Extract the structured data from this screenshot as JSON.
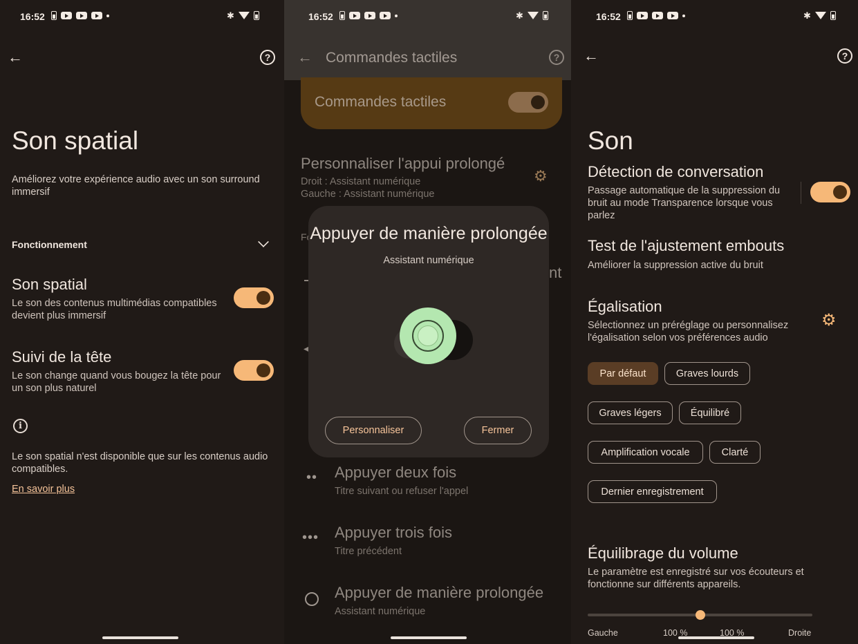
{
  "status": {
    "time": "16:52"
  },
  "panel1": {
    "title": "Son spatial",
    "description": "Améliorez votre expérience audio avec un son surround immersif",
    "section": "Fonctionnement",
    "spatial": {
      "title": "Son spatial",
      "subtitle": "Le son des contenus multimédias compatibles devient plus immersif",
      "on": true
    },
    "head_tracking": {
      "title": "Suivi de la tête",
      "subtitle": "Le son change quand vous bougez la tête pour un son plus naturel",
      "on": true
    },
    "note": "Le son spatial n'est disponible que sur les contenus audio compatibles.",
    "link": "En savoir plus"
  },
  "panel2": {
    "appbar_title": "Commandes tactiles",
    "banner_label": "Commandes tactiles",
    "banner_on": true,
    "customize": {
      "title": "Personnaliser l'appui prolongé",
      "right": "Droit : Assistant numérique",
      "left": "Gauche : Assistant numérique"
    },
    "peek_left": "Fo",
    "peek_right": "nt",
    "modal": {
      "title": "Appuyer de manière prolongée",
      "subtitle": "Assistant numérique",
      "btn_customize": "Personnaliser",
      "btn_close": "Fermer"
    },
    "gestures": [
      {
        "title": "Appuyer deux fois",
        "subtitle": "Titre suivant ou refuser l'appel",
        "icon": "••"
      },
      {
        "title": "Appuyer trois fois",
        "subtitle": "Titre précédent",
        "icon": "•••"
      },
      {
        "title": "Appuyer de manière prolongée",
        "subtitle": "Assistant numérique",
        "icon": "radio"
      }
    ]
  },
  "panel3": {
    "title": "Son",
    "conversation": {
      "title": "Détection de conversation",
      "subtitle": "Passage automatique de la suppression du bruit au mode Transparence lorsque vous parlez",
      "on": true
    },
    "fit_test": {
      "title": "Test de l'ajustement embouts",
      "subtitle": "Améliorer la suppression active du bruit"
    },
    "eq": {
      "title": "Égalisation",
      "subtitle": "Sélectionnez un préréglage ou personnalisez l'égalisation selon vos préférences audio"
    },
    "presets": [
      "Par défaut",
      "Graves lourds",
      "Graves légers",
      "Équilibré",
      "Amplification vocale",
      "Clarté",
      "Dernier enregistrement"
    ],
    "selected_preset": "Par défaut",
    "balance": {
      "title": "Équilibrage du volume",
      "subtitle": "Le paramètre est enregistré sur vos écouteurs et fonctionne sur différents appareils.",
      "left_label": "Gauche",
      "right_label": "Droite",
      "left_value": "100 %",
      "right_value": "100 %",
      "position": 0.5
    }
  }
}
